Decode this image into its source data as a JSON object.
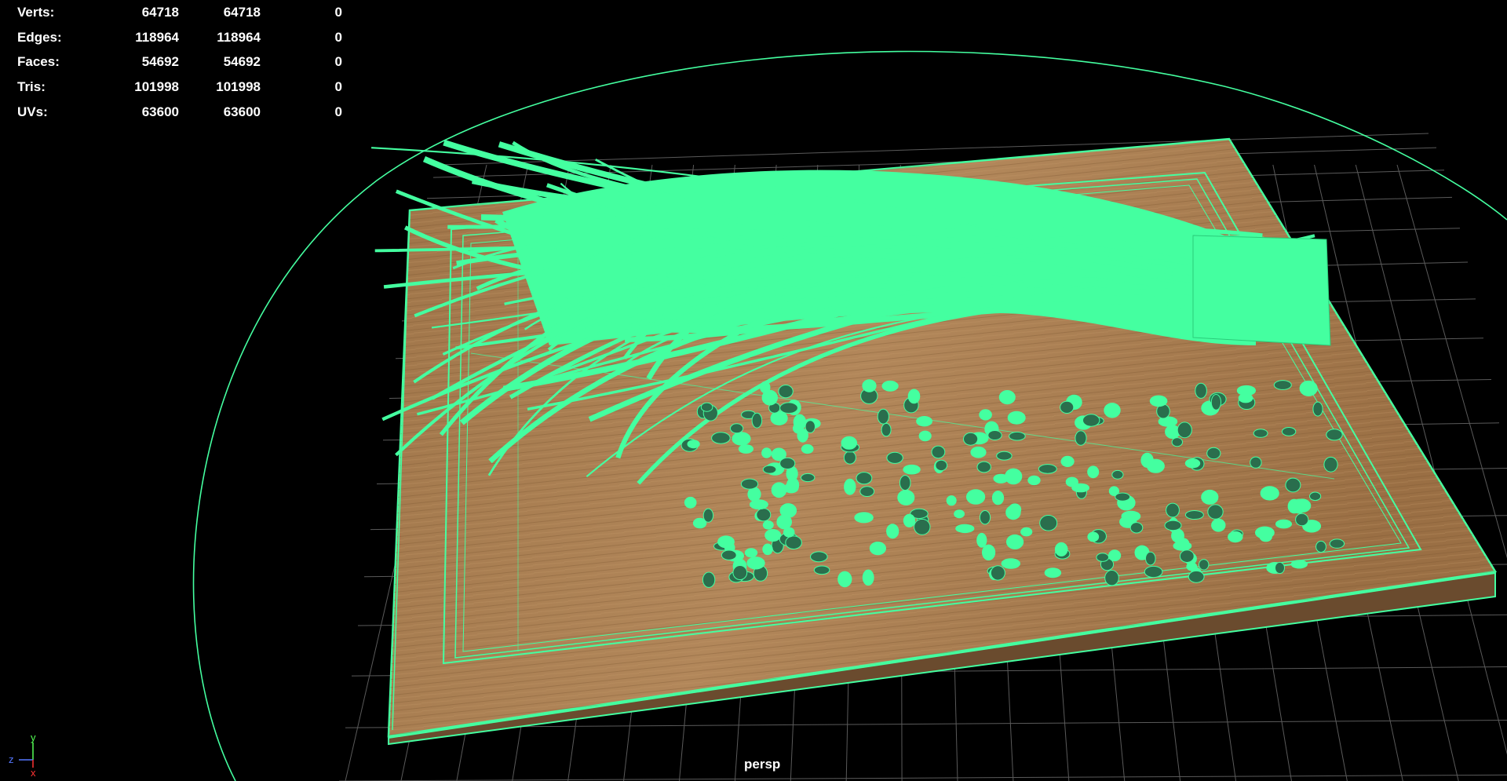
{
  "hud": {
    "rows": [
      {
        "label": "Verts:",
        "values": [
          "64718",
          "64718",
          "0"
        ]
      },
      {
        "label": "Edges:",
        "values": [
          "118964",
          "118964",
          "0"
        ]
      },
      {
        "label": "Faces:",
        "values": [
          "54692",
          "54692",
          "0"
        ]
      },
      {
        "label": "Tris:",
        "values": [
          "101998",
          "101998",
          "0"
        ]
      },
      {
        "label": "UVs:",
        "values": [
          "63600",
          "63600",
          "0"
        ]
      }
    ]
  },
  "viewport": {
    "camera_label": "persp",
    "axis_labels": {
      "y": "y",
      "z": "z",
      "x": "x"
    }
  },
  "colors": {
    "background": "#000000",
    "wireframe_selected": "#44ffa0",
    "grid": "#5a5a5a",
    "wood": "#a87c4e",
    "hud_text": "#ffffff",
    "axis_y": "#55ff55",
    "axis_z": "#5577ff",
    "axis_x": "#ff3333"
  }
}
